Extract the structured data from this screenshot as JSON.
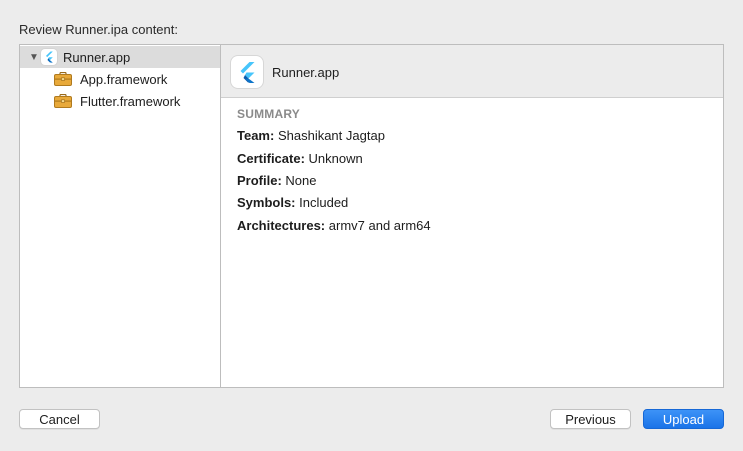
{
  "window": {
    "heading": "Review Runner.ipa content:"
  },
  "sidebar": {
    "items": [
      {
        "label": "Runner.app",
        "icon": "flutter-app-icon",
        "expanded": true,
        "selected": true
      },
      {
        "label": "App.framework",
        "icon": "briefcase-icon"
      },
      {
        "label": "Flutter.framework",
        "icon": "briefcase-icon"
      }
    ]
  },
  "detail": {
    "title": "Runner.app",
    "summary_heading": "SUMMARY",
    "fields": [
      {
        "key": "Team:",
        "value": "Shashikant Jagtap"
      },
      {
        "key": "Certificate:",
        "value": "Unknown"
      },
      {
        "key": "Profile:",
        "value": "None"
      },
      {
        "key": "Symbols:",
        "value": "Included"
      },
      {
        "key": "Architectures:",
        "value": "armv7 and arm64"
      }
    ]
  },
  "buttons": {
    "cancel": "Cancel",
    "previous": "Previous",
    "upload": "Upload"
  },
  "colors": {
    "accent": "#1a73e8",
    "selection": "#dcdcdc",
    "flutter_light": "#47c5fb",
    "flutter_dark": "#0a5cad",
    "briefcase": "#e8a93a"
  }
}
